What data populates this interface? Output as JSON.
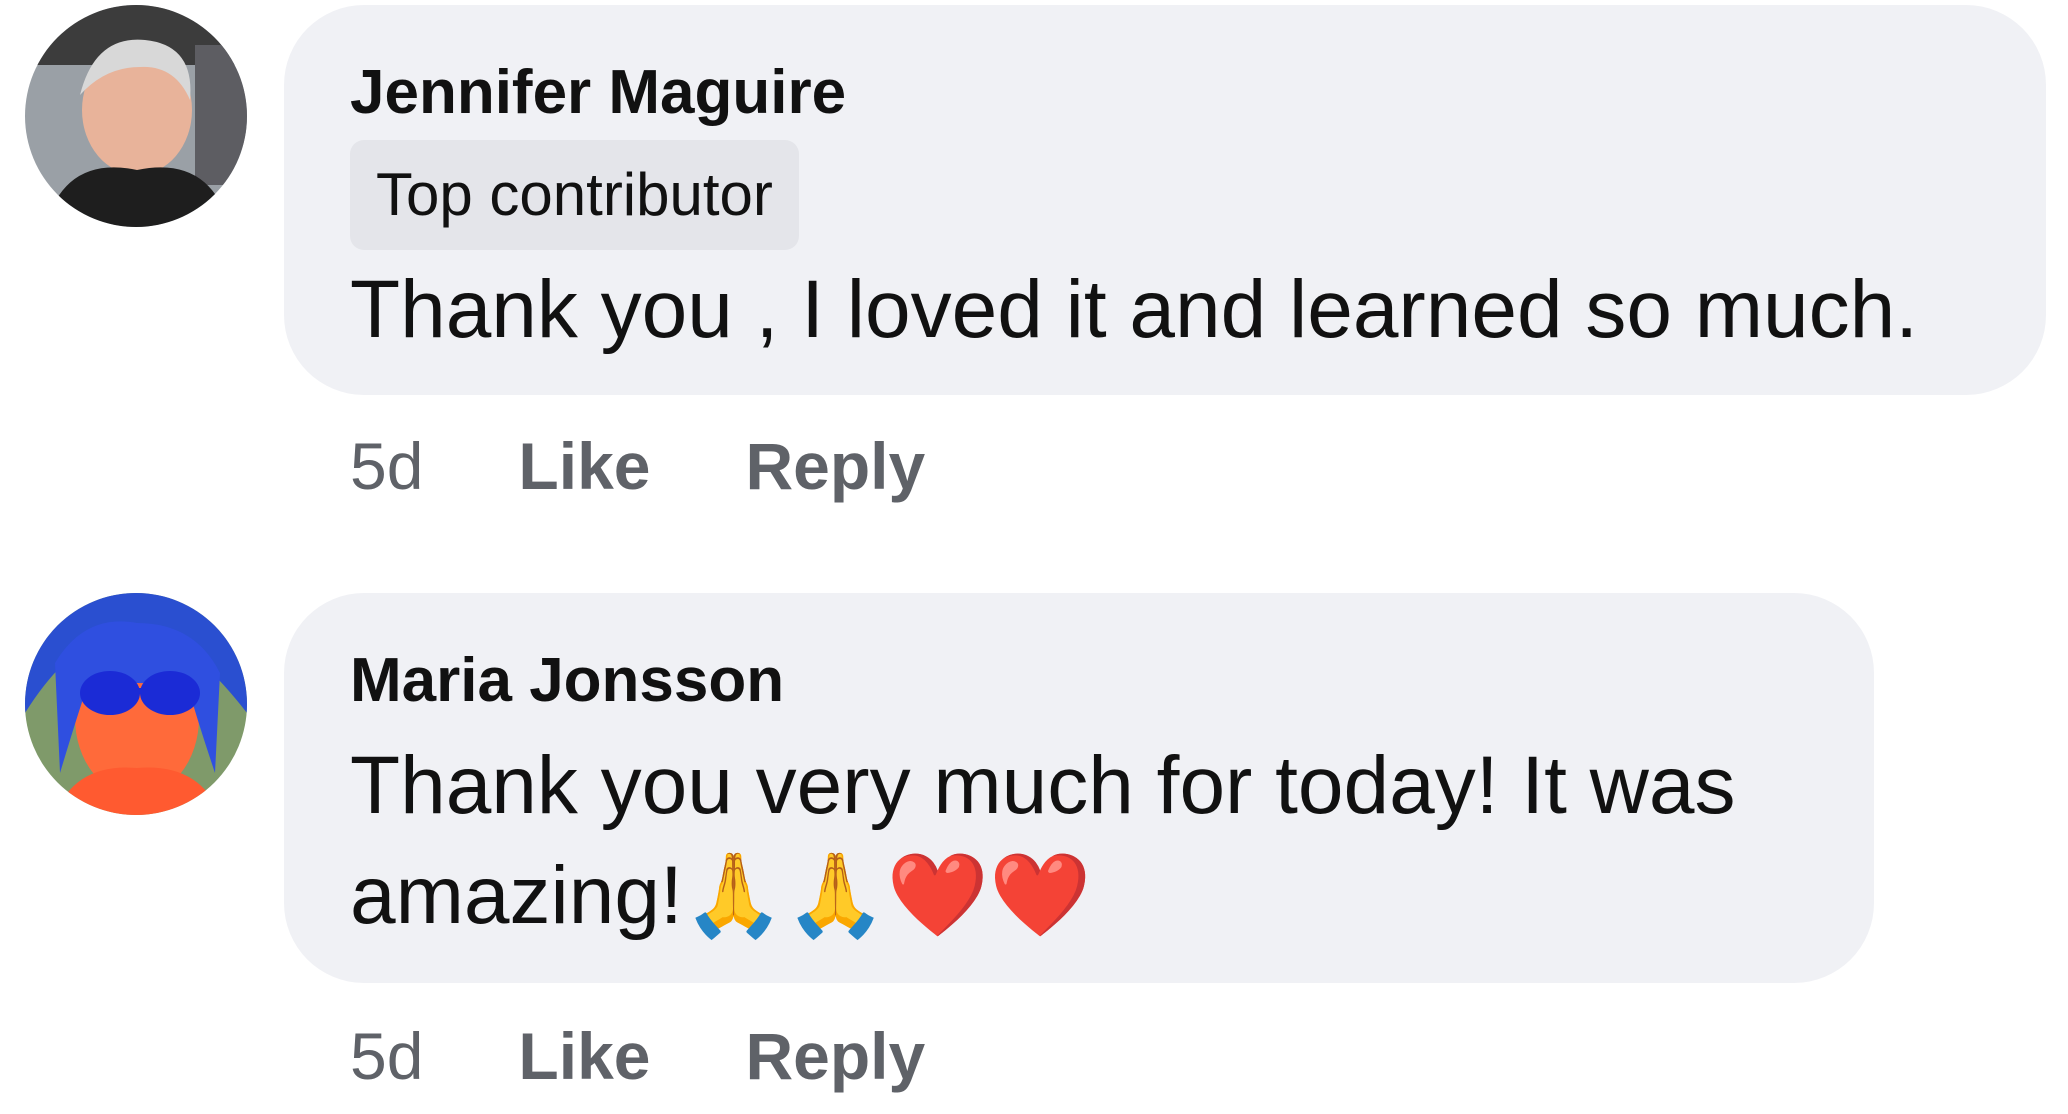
{
  "comments": [
    {
      "author": "Jennifer Maguire",
      "badge": "Top contributor",
      "text": "Thank you , I loved it and learned so much.",
      "time": "5d",
      "like_label": "Like",
      "reply_label": "Reply",
      "avatar_icon": "avatar-photo"
    },
    {
      "author": "Maria Jonsson",
      "text_line1": "Thank you very much for today! It was",
      "text_line2": "amazing!",
      "emojis": "🙏🙏❤️❤️",
      "time": "5d",
      "like_label": "Like",
      "reply_label": "Reply",
      "avatar_icon": "avatar-photo"
    }
  ],
  "colors": {
    "bubble": "#f0f1f5",
    "badge": "#e4e5ea",
    "meta_text": "#5f6268"
  }
}
